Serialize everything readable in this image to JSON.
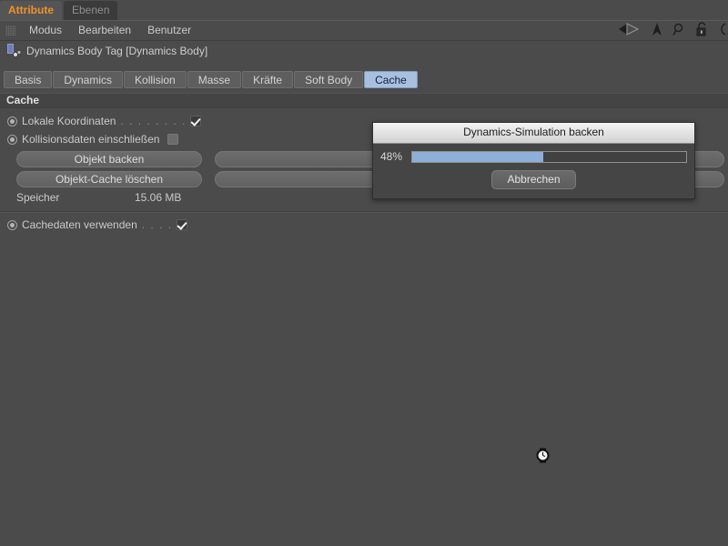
{
  "dock_tabs": [
    {
      "label": "Attribute",
      "active": true
    },
    {
      "label": "Ebenen",
      "active": false
    }
  ],
  "menubar": {
    "grip_icon": "dotted-grip-icon",
    "items": [
      "Modus",
      "Bearbeiten",
      "Benutzer"
    ],
    "icons": [
      "back-arrow-icon",
      "up-arrow-icon",
      "search-icon",
      "lock-open-icon",
      "circle-icon"
    ]
  },
  "object_header": {
    "icon": "dynamics-body-tag-icon",
    "title": "Dynamics Body Tag [Dynamics Body]"
  },
  "attribute_tabs": [
    {
      "label": "Basis",
      "selected": false
    },
    {
      "label": "Dynamics",
      "selected": false
    },
    {
      "label": "Kollision",
      "selected": false
    },
    {
      "label": "Masse",
      "selected": false
    },
    {
      "label": "Kräfte",
      "selected": false
    },
    {
      "label": "Soft Body",
      "selected": false
    },
    {
      "label": "Cache",
      "selected": true
    }
  ],
  "panel": {
    "group_title": "Cache",
    "rows": [
      {
        "label": "Lokale Koordinaten",
        "dots": ". . . . . . . .",
        "checked": true
      },
      {
        "label": "Kollisionsdaten einschließen",
        "dots": "",
        "checked": false
      }
    ],
    "buttons_left": [
      "Objekt backen",
      "Objekt-Cache löschen"
    ],
    "buttons_right": [
      "",
      ""
    ],
    "memory": {
      "label": "Speicher",
      "value": "15.06 MB"
    },
    "use_cache_row": {
      "label": "Cachedaten verwenden",
      "dots": ". . . .",
      "checked": true
    }
  },
  "dialog": {
    "title": "Dynamics-Simulation backen",
    "percent_label": "48%",
    "progress_value": 48,
    "progress_max": 100,
    "cancel_label": "Abbrechen"
  },
  "cursor": {
    "icon": "busy-watch-cursor"
  },
  "colors": {
    "accent_tab_text": "#f0922a",
    "selected_tab_bg": "#a8c0e0",
    "progress_fill": "#8cb0d8",
    "panel_bg": "#4b4b4b"
  }
}
